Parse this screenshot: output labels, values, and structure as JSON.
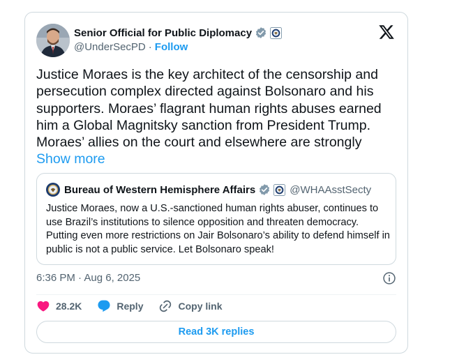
{
  "author": {
    "name": "Senior Official for Public Diplomacy",
    "handle": "@UnderSecPD",
    "separator": "·",
    "follow_label": "Follow"
  },
  "tweet": {
    "text": "Justice Moraes is the key architect of the censorship and persecution complex directed against Bolsonaro and his supporters. Moraes’ flagrant human rights abuses earned him a Global Magnitsky sanction from President Trump. Moraes’ allies on the court and elsewhere are strongly ",
    "show_more": "Show more",
    "timestamp": "6:36 PM · Aug 6, 2025"
  },
  "quote": {
    "name": "Bureau of Western Hemisphere Affairs",
    "handle": "@WHAAsstSecty",
    "text": "Justice Moraes, now a U.S.-sanctioned human rights abuser, continues to use Brazil’s institutions to silence opposition and threaten democracy. Putting even more restrictions on Jair Bolsonaro’s ability to defend himself in public is not a public service. Let Bolsonaro speak!"
  },
  "actions": {
    "likes": "28.2K",
    "reply": "Reply",
    "copy_link": "Copy link"
  },
  "replies_button": "Read 3K replies",
  "colors": {
    "accent": "#1d9bf0",
    "like": "#f91880",
    "verified_gray": "#829aab",
    "secondary_text": "#536471",
    "border": "#cfd9de"
  },
  "icons": [
    "x-logo-icon",
    "verified-badge-icon",
    "government-seal-icon",
    "heart-icon",
    "reply-icon",
    "link-icon",
    "info-icon"
  ]
}
